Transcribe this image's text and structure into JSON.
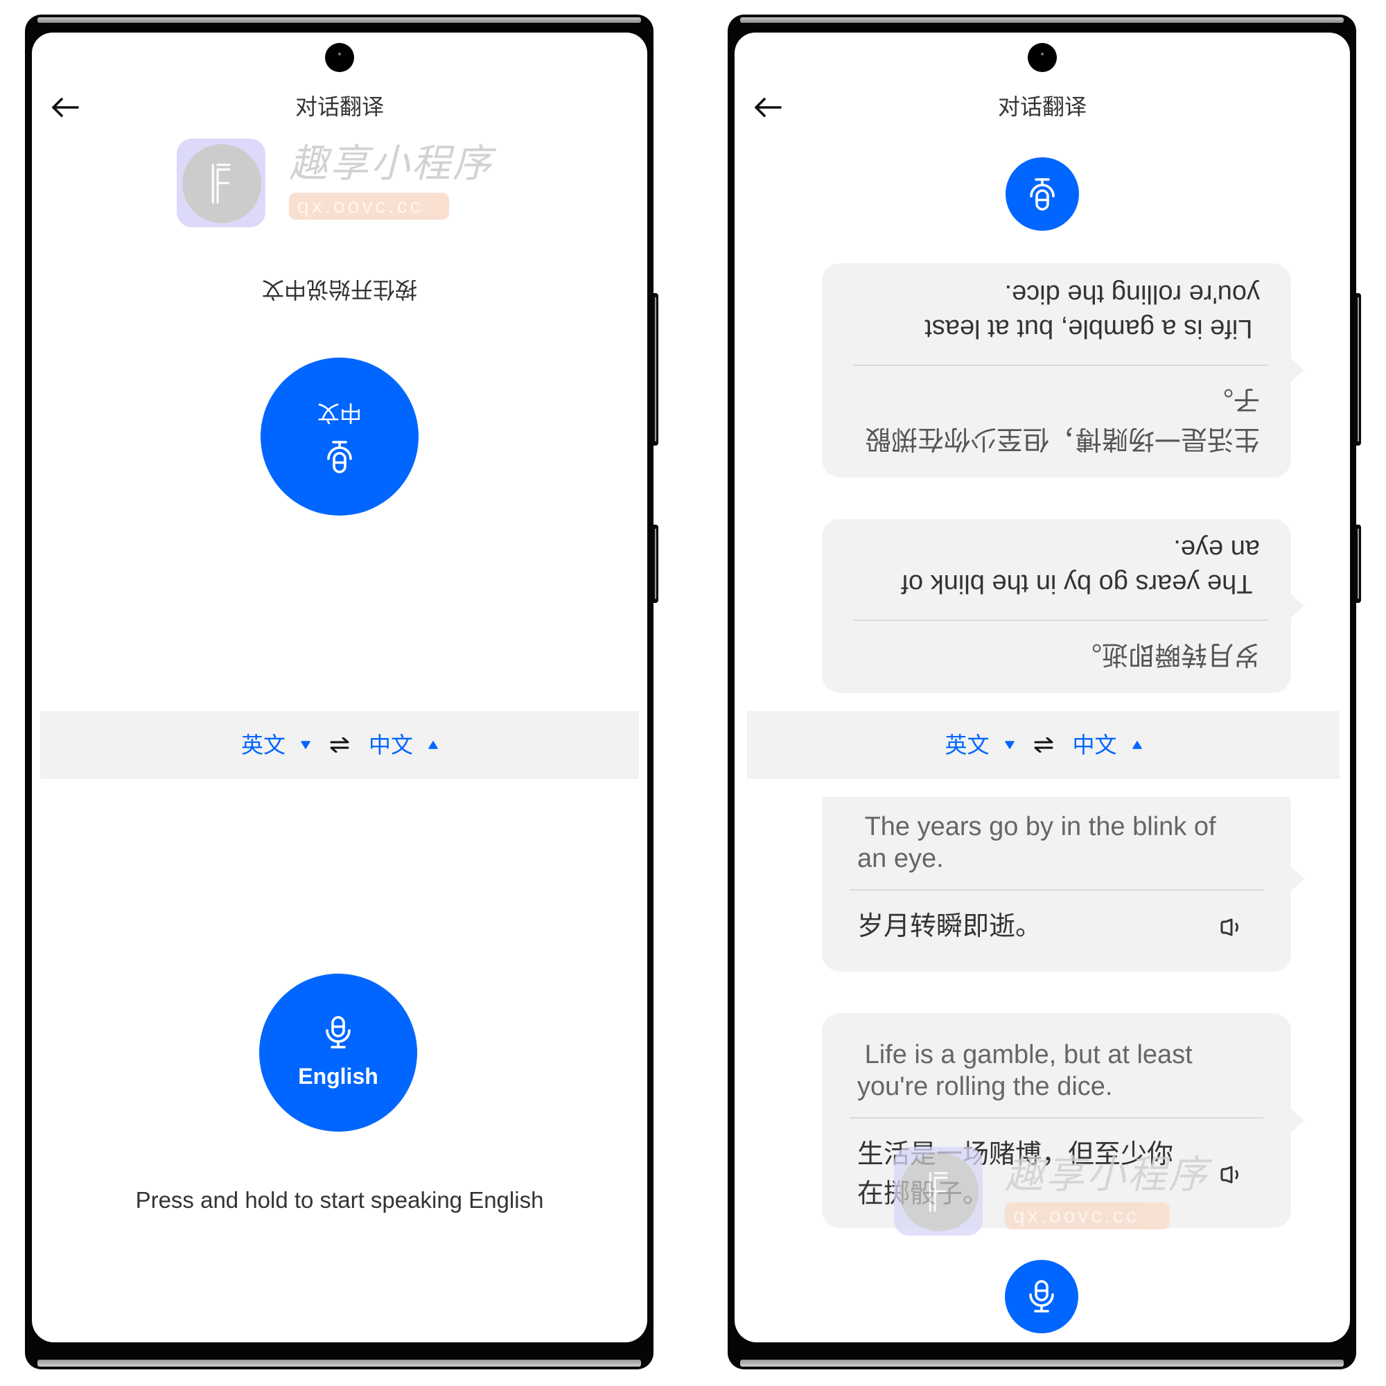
{
  "colors": {
    "accent": "#0066ff",
    "bubble_bg": "#f2f2f2",
    "language_bar_bg": "#f2f2f2",
    "text_primary": "#333333",
    "text_secondary": "#666666"
  },
  "watermark": {
    "brand": "趣享小程序",
    "domain": "qx.oovc.cc"
  },
  "left_screen": {
    "header": {
      "title": "对话翻译",
      "back_icon": "arrow-left-icon"
    },
    "chinese_speaker_panel": {
      "hint": "按住开始说中文",
      "button_label": "中文",
      "button_icon": "microphone-icon"
    },
    "language_bar": {
      "source_language": "英文",
      "source_caret_icon": "caret-down-icon",
      "swap_icon": "swap-icon",
      "target_language": "中文",
      "target_caret_icon": "caret-up-icon"
    },
    "english_speaker_panel": {
      "button_label": "English",
      "button_icon": "microphone-icon",
      "hint": "Press and hold to start speaking English"
    }
  },
  "right_screen": {
    "header": {
      "title": "对话翻译",
      "back_icon": "arrow-left-icon"
    },
    "top_mic_button_icon": "microphone-icon",
    "top_messages": [
      {
        "translation": "生活是一场赌博，但至少你在掷骰子。",
        "original": " Life is a gamble, but at least you're rolling the dice."
      },
      {
        "translation": "岁月转瞬即逝。",
        "original": " The years go by in the blink of an eye."
      }
    ],
    "language_bar": {
      "source_language": "英文",
      "source_caret_icon": "caret-down-icon",
      "swap_icon": "swap-icon",
      "target_language": "中文",
      "target_caret_icon": "caret-up-icon"
    },
    "bottom_messages": [
      {
        "original": " The years go by in the blink of an eye.",
        "translation": "岁月转瞬即逝。",
        "play_icon": "speaker-icon"
      },
      {
        "original": " Life is a gamble, but at least you're rolling the dice.",
        "translation": "生活是一场赌博，但至少你在掷骰子。",
        "play_icon": "speaker-icon"
      }
    ],
    "bottom_mic_button_icon": "microphone-icon"
  }
}
